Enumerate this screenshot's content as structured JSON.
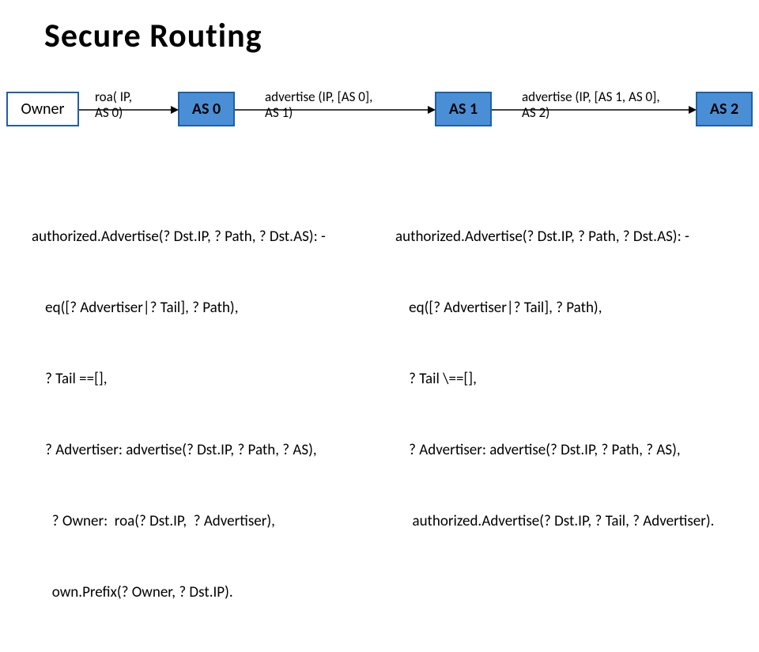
{
  "title": "Secure Routing",
  "chart_data": {
    "type": "table",
    "nodes": [
      {
        "id": "Owner",
        "label": "Owner",
        "style": "white"
      },
      {
        "id": "AS0",
        "label": "AS 0",
        "style": "blue"
      },
      {
        "id": "AS1",
        "label": "AS 1",
        "style": "blue"
      },
      {
        "id": "AS2",
        "label": "AS 2",
        "style": "blue"
      }
    ],
    "edges": [
      {
        "from": "Owner",
        "to": "AS0",
        "label_lines": [
          "roa( IP,",
          "AS 0)"
        ]
      },
      {
        "from": "AS0",
        "to": "AS1",
        "label_lines": [
          "advertise (IP, [AS 0],",
          "AS 1)"
        ]
      },
      {
        "from": "AS1",
        "to": "AS2",
        "label_lines": [
          "advertise (IP, [AS 1, AS 0],",
          "AS 2)"
        ]
      }
    ]
  },
  "rules": {
    "left": [
      "authorized.Advertise(? Dst.IP, ? Path, ? Dst.AS): -",
      "    eq([? Advertiser|? Tail], ? Path),",
      "    ? Tail ==[],",
      "    ? Advertiser: advertise(? Dst.IP, ? Path, ? AS),",
      "      ? Owner:  roa(? Dst.IP,  ? Advertiser),",
      "      own.Prefix(? Owner, ? Dst.IP)."
    ],
    "right": [
      "authorized.Advertise(? Dst.IP, ? Path, ? Dst.AS): -",
      "    eq([? Advertiser|? Tail], ? Path),",
      "    ? Tail \\==[],",
      "    ? Advertiser: advertise(? Dst.IP, ? Path, ? AS),",
      "     authorized.Advertise(? Dst.IP, ? Tail, ? Advertiser)."
    ]
  }
}
